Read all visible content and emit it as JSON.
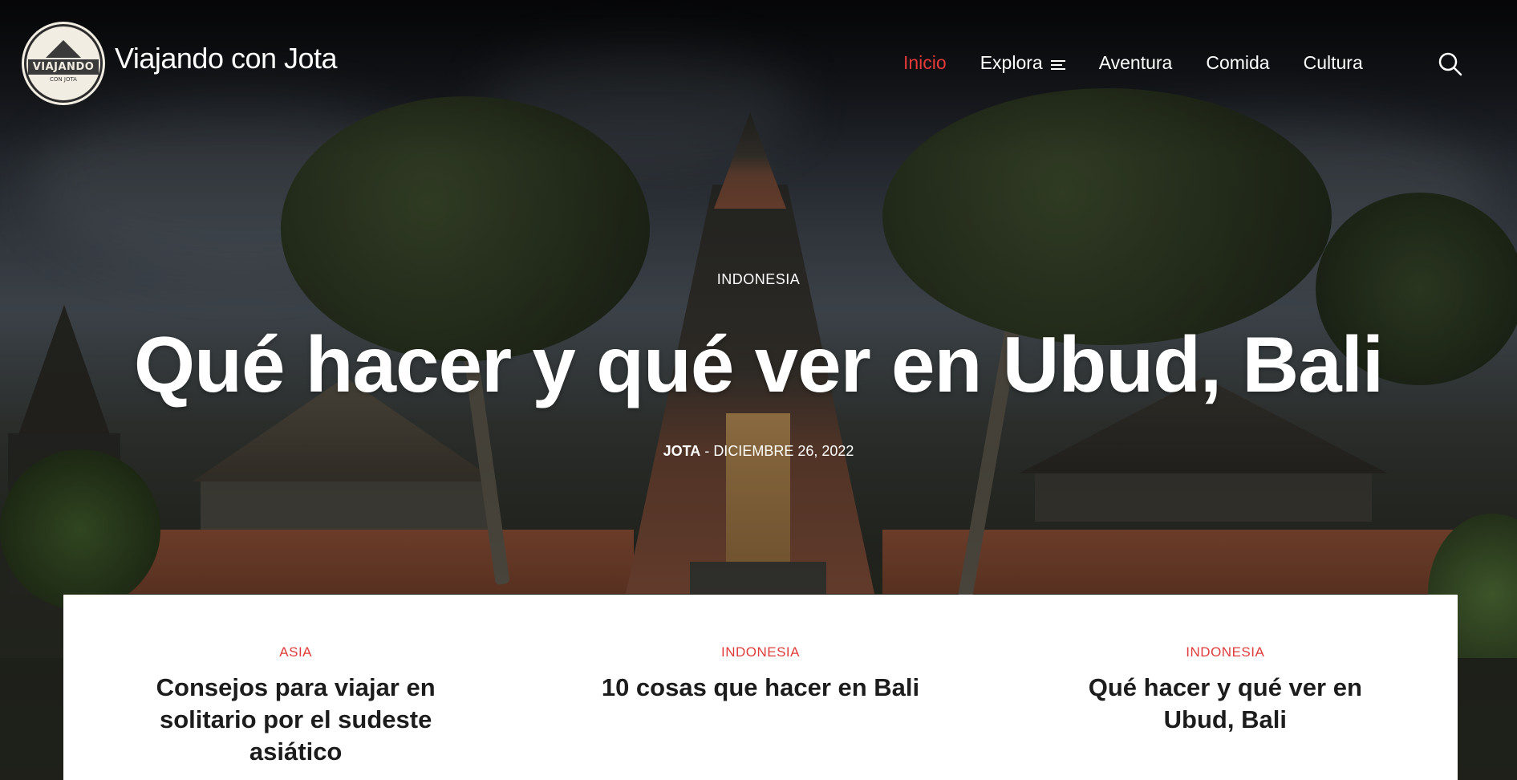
{
  "site": {
    "title": "Viajando con Jota",
    "logo_text": "VIAJANDO",
    "logo_subtext": "CON JOTA"
  },
  "nav": {
    "items": [
      {
        "label": "Inicio",
        "active": true
      },
      {
        "label": "Explora",
        "has_menu_icon": true
      },
      {
        "label": "Aventura"
      },
      {
        "label": "Comida"
      },
      {
        "label": "Cultura"
      }
    ],
    "search_icon": "search-icon"
  },
  "hero": {
    "category": "INDONESIA",
    "title": "Qué hacer y qué ver en Ubud, Bali",
    "author": "JOTA",
    "separator": "-",
    "date": "DICIEMBRE 26, 2022"
  },
  "cards": [
    {
      "category": "ASIA",
      "title": "Consejos para viajar en solitario por el sudeste asiático"
    },
    {
      "category": "INDONESIA",
      "title": "10 cosas que hacer en Bali"
    },
    {
      "category": "INDONESIA",
      "title": "Qué hacer y qué ver en Ubud, Bali"
    }
  ],
  "colors": {
    "accent": "#e63a3a",
    "text_light": "#ffffff",
    "text_dark": "#1c1c1c",
    "card_bg": "#ffffff"
  }
}
